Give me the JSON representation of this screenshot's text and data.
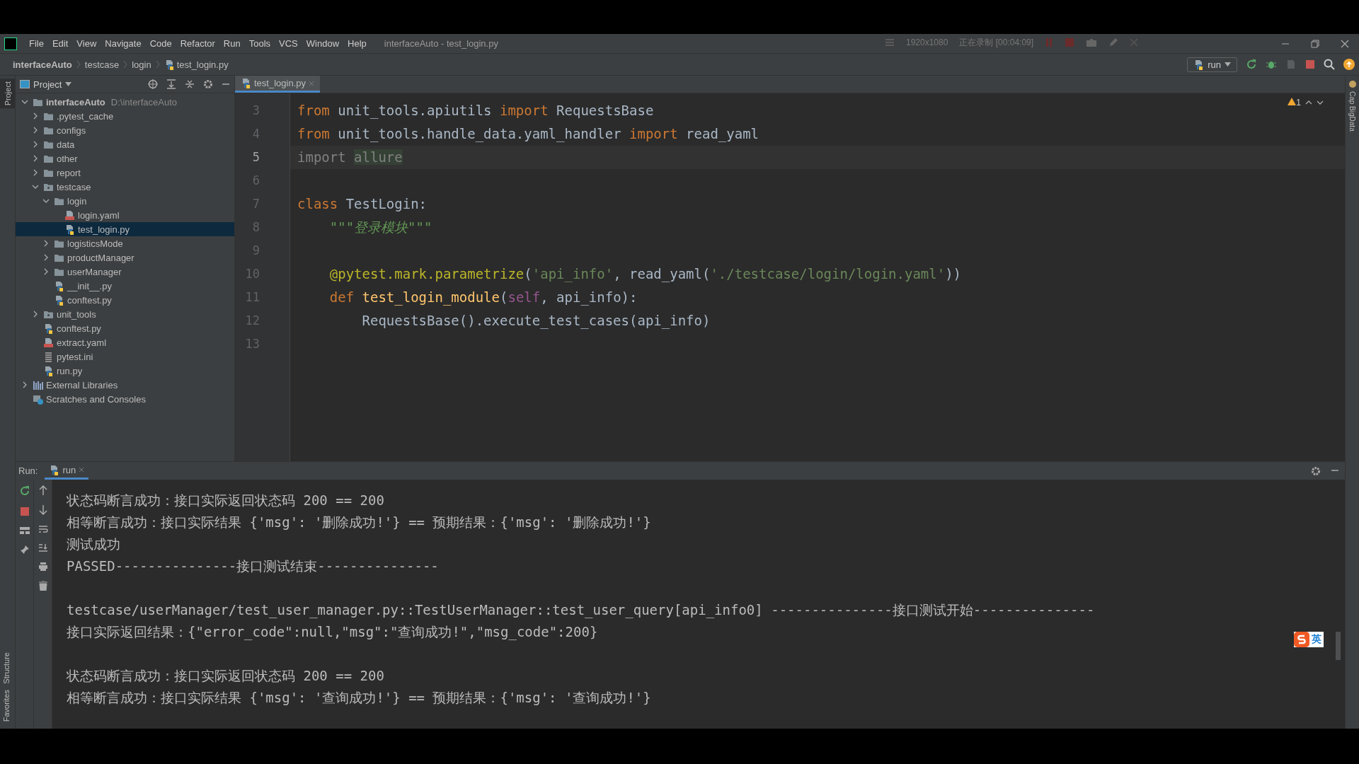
{
  "window": {
    "title": "interfaceAuto - test_login.py",
    "menu": [
      "File",
      "Edit",
      "View",
      "Navigate",
      "Code",
      "Refactor",
      "Run",
      "Tools",
      "VCS",
      "Window",
      "Help"
    ]
  },
  "recorder": {
    "resolution": "1920x1080",
    "status": "正在录制 [00:04:09]"
  },
  "breadcrumb": [
    "interfaceAuto",
    "testcase",
    "login",
    "test_login.py"
  ],
  "run_config": {
    "label": "run"
  },
  "side_tabs": {
    "left_top": "Project",
    "left_bottom": [
      "Structure",
      "Favorites"
    ],
    "right": "Cap BigData"
  },
  "project_panel": {
    "title": "Project",
    "tree": [
      {
        "label": "interfaceAuto",
        "path": "D:\\interfaceAuto",
        "kind": "folder",
        "expanded": true,
        "selected": false,
        "children": [
          {
            "label": ".pytest_cache",
            "kind": "folder",
            "expanded": false,
            "selected": false
          },
          {
            "label": "configs",
            "kind": "folder",
            "expanded": false,
            "selected": false
          },
          {
            "label": "data",
            "kind": "folder",
            "expanded": false,
            "selected": false
          },
          {
            "label": "other",
            "kind": "folder",
            "expanded": false,
            "selected": false
          },
          {
            "label": "report",
            "kind": "folder",
            "expanded": false,
            "selected": false
          },
          {
            "label": "testcase",
            "kind": "package",
            "expanded": true,
            "selected": false,
            "children": [
              {
                "label": "login",
                "kind": "folder",
                "expanded": true,
                "selected": false,
                "children": [
                  {
                    "label": "login.yaml",
                    "kind": "yaml",
                    "selected": false
                  },
                  {
                    "label": "test_login.py",
                    "kind": "python",
                    "selected": true
                  }
                ]
              },
              {
                "label": "logisticsMode",
                "kind": "folder",
                "expanded": false,
                "selected": false
              },
              {
                "label": "productManager",
                "kind": "folder",
                "expanded": false,
                "selected": false
              },
              {
                "label": "userManager",
                "kind": "folder",
                "expanded": false,
                "selected": false
              },
              {
                "label": "__init__.py",
                "kind": "python",
                "selected": false
              },
              {
                "label": "conftest.py",
                "kind": "python",
                "selected": false
              }
            ]
          },
          {
            "label": "unit_tools",
            "kind": "package",
            "expanded": false,
            "selected": false
          },
          {
            "label": "conftest.py",
            "kind": "python",
            "selected": false
          },
          {
            "label": "extract.yaml",
            "kind": "yaml",
            "selected": false
          },
          {
            "label": "pytest.ini",
            "kind": "ini",
            "selected": false
          },
          {
            "label": "run.py",
            "kind": "python",
            "selected": false
          }
        ]
      },
      {
        "label": "External Libraries",
        "kind": "libraries",
        "expanded": false,
        "selected": false
      },
      {
        "label": "Scratches and Consoles",
        "kind": "scratches",
        "selected": false
      }
    ]
  },
  "editor": {
    "tabs": [
      {
        "label": "test_login.py",
        "selected": true
      }
    ],
    "warnings": "1",
    "lines": [
      {
        "number": "3",
        "current": false,
        "tokens": [
          {
            "text": "from",
            "kind": "kw"
          },
          {
            "text": " unit_tools.apiutils ",
            "kind": "plain"
          },
          {
            "text": "import",
            "kind": "kw"
          },
          {
            "text": " RequestsBase",
            "kind": "plain"
          }
        ]
      },
      {
        "number": "4",
        "current": false,
        "tokens": [
          {
            "text": "from",
            "kind": "kw"
          },
          {
            "text": " unit_tools.handle_data.yaml_handler ",
            "kind": "plain"
          },
          {
            "text": "import",
            "kind": "kw"
          },
          {
            "text": " read_yaml",
            "kind": "plain"
          }
        ]
      },
      {
        "number": "5",
        "current": true,
        "tokens": [
          {
            "text": "import ",
            "kind": "unused"
          },
          {
            "text": "allure",
            "kind": "unused-hl"
          }
        ]
      },
      {
        "number": "6",
        "current": false
      },
      {
        "number": "7",
        "current": false,
        "tokens": [
          {
            "text": "class",
            "kind": "kw"
          },
          {
            "text": " TestLogin:",
            "kind": "plain"
          }
        ]
      },
      {
        "number": "8",
        "current": false,
        "tokens": [
          {
            "text": "    \"\"\"登录模块\"\"\"",
            "kind": "doc"
          }
        ]
      },
      {
        "number": "9",
        "current": false
      },
      {
        "number": "10",
        "current": false,
        "tokens": [
          {
            "text": "    @pytest.mark.parametrize",
            "kind": "deco"
          },
          {
            "text": "(",
            "kind": "plain"
          },
          {
            "text": "'api_info'",
            "kind": "str"
          },
          {
            "text": ", read_yaml(",
            "kind": "plain"
          },
          {
            "text": "'./testcase/login/login.yaml'",
            "kind": "str"
          },
          {
            "text": "))",
            "kind": "plain"
          }
        ]
      },
      {
        "number": "11",
        "current": false,
        "tokens": [
          {
            "text": "    def",
            "kind": "kw"
          },
          {
            "text": " test_login_module",
            "kind": "fn"
          },
          {
            "text": "(",
            "kind": "plain"
          },
          {
            "text": "self",
            "kind": "self"
          },
          {
            "text": ", api_info):",
            "kind": "plain"
          }
        ]
      },
      {
        "number": "12",
        "current": false,
        "tokens": [
          {
            "text": "        RequestsBase().execute_test_cases(api_info)",
            "kind": "plain"
          }
        ]
      },
      {
        "number": "13",
        "current": false
      }
    ]
  },
  "run_panel": {
    "label": "Run:",
    "tabs": [
      {
        "label": "run",
        "selected": true
      }
    ],
    "console": [
      [
        "状态码断言成功：接口实际返回状态码 200 == 200",
        "相等断言成功：接口实际结果 {'msg': '删除成功!'} == 预期结果：{'msg': '删除成功!'}",
        "测试成功",
        "PASSED---------------接口测试结束---------------"
      ],
      [
        "testcase/userManager/test_user_manager.py::TestUserManager::test_user_query[api_info0] ---------------接口测试开始---------------",
        "接口实际返回结果：{\"error_code\":null,\"msg\":\"查询成功!\",\"msg_code\":200}"
      ],
      [
        "状态码断言成功：接口实际返回状态码 200 == 200",
        "相等断言成功：接口实际结果 {'msg': '查询成功!'} == 预期结果：{'msg': '查询成功!'}"
      ]
    ]
  },
  "ime": {
    "mode": "英"
  }
}
